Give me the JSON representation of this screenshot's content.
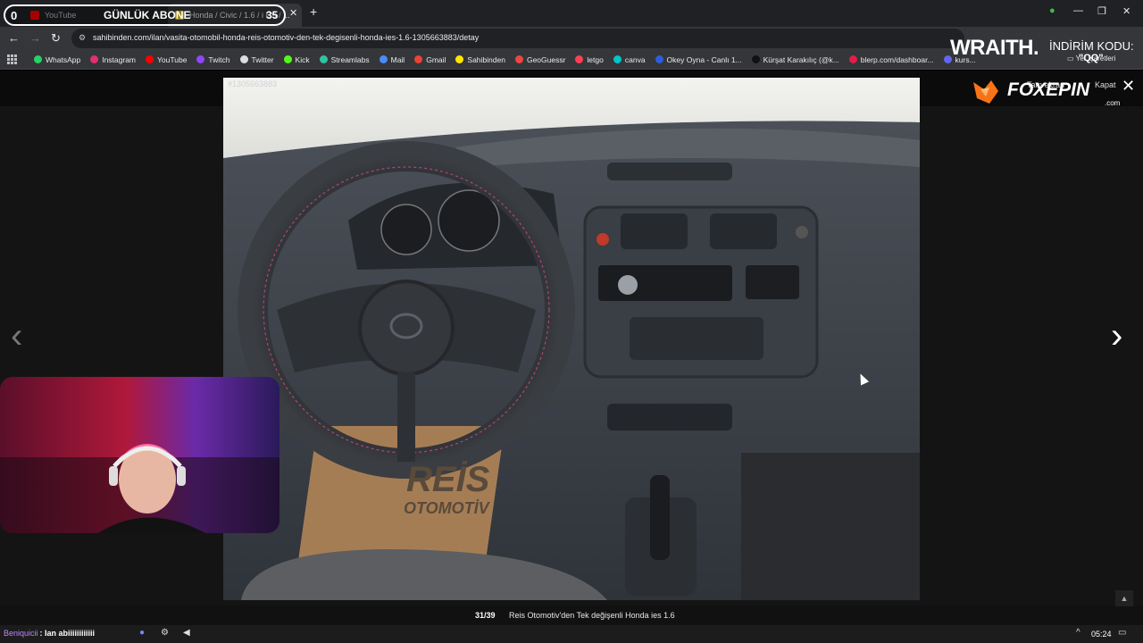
{
  "browser": {
    "tabs": [
      {
        "label": "YouTube",
        "favicon": "youtube-icon"
      },
      {
        "label": "Honda / Civic / 1.6 / i ES / ...",
        "favicon": "sahibinden-icon"
      }
    ],
    "url": "sahibinden.com/ilan/vasita-otomobil-honda-reis-otomotiv-den-tek-degisenli-honda-ies-1.6-1305663883/detay",
    "bookmarks": [
      {
        "label": "WhatsApp",
        "color": "#25d366"
      },
      {
        "label": "Instagram",
        "color": "#e1306c"
      },
      {
        "label": "YouTube",
        "color": "#ff0000"
      },
      {
        "label": "Twitch",
        "color": "#9146ff"
      },
      {
        "label": "Twitter",
        "color": "#dddddd"
      },
      {
        "label": "Kick",
        "color": "#53fc18"
      },
      {
        "label": "Streamlabs",
        "color": "#31c3a2"
      },
      {
        "label": "Mail",
        "color": "#4a8cf7"
      },
      {
        "label": "Gmail",
        "color": "#ea4335"
      },
      {
        "label": "Sahibinden",
        "color": "#ffe800"
      },
      {
        "label": "GeoGuessr",
        "color": "#ef4444"
      },
      {
        "label": "letgo",
        "color": "#ff3f55"
      },
      {
        "label": "canva",
        "color": "#00c4cc"
      },
      {
        "label": "Okey Oyna - Canlı 1...",
        "color": "#2b5fd9"
      },
      {
        "label": "Kürşat Karakılıç (@k...",
        "color": "#111111"
      },
      {
        "label": "blerp.com/dashboar...",
        "color": "#e11d48"
      },
      {
        "label": "kurs...",
        "color": "#6366f1"
      }
    ],
    "bookmarks_folder": "Yer İşaretleri"
  },
  "overlay": {
    "left_count": "0",
    "title": "GÜNLÜK ABONE",
    "right_count": "35",
    "sponsor_brand": "WRAITH.",
    "promo_label": "İNDİRİM KODU:",
    "promo_code": "\"QQ\"",
    "foxepin": "FOXEPIN",
    "foxepin_domain": ".com"
  },
  "gallery": {
    "listing_id": "#1305663883",
    "controls": [
      "Tam ekran",
      "Kapat"
    ],
    "counter": "31/39",
    "caption": "Reis Otomotiv'den Tek değişenli Honda ies 1.6",
    "watermark_brand": "REİS",
    "watermark_sub": "OTOMOTİV"
  },
  "taskbar": {
    "chat_user": "Beniquicii",
    "chat_message": ": Ian abiiiiiiiiiiii",
    "clock": "05:24"
  }
}
